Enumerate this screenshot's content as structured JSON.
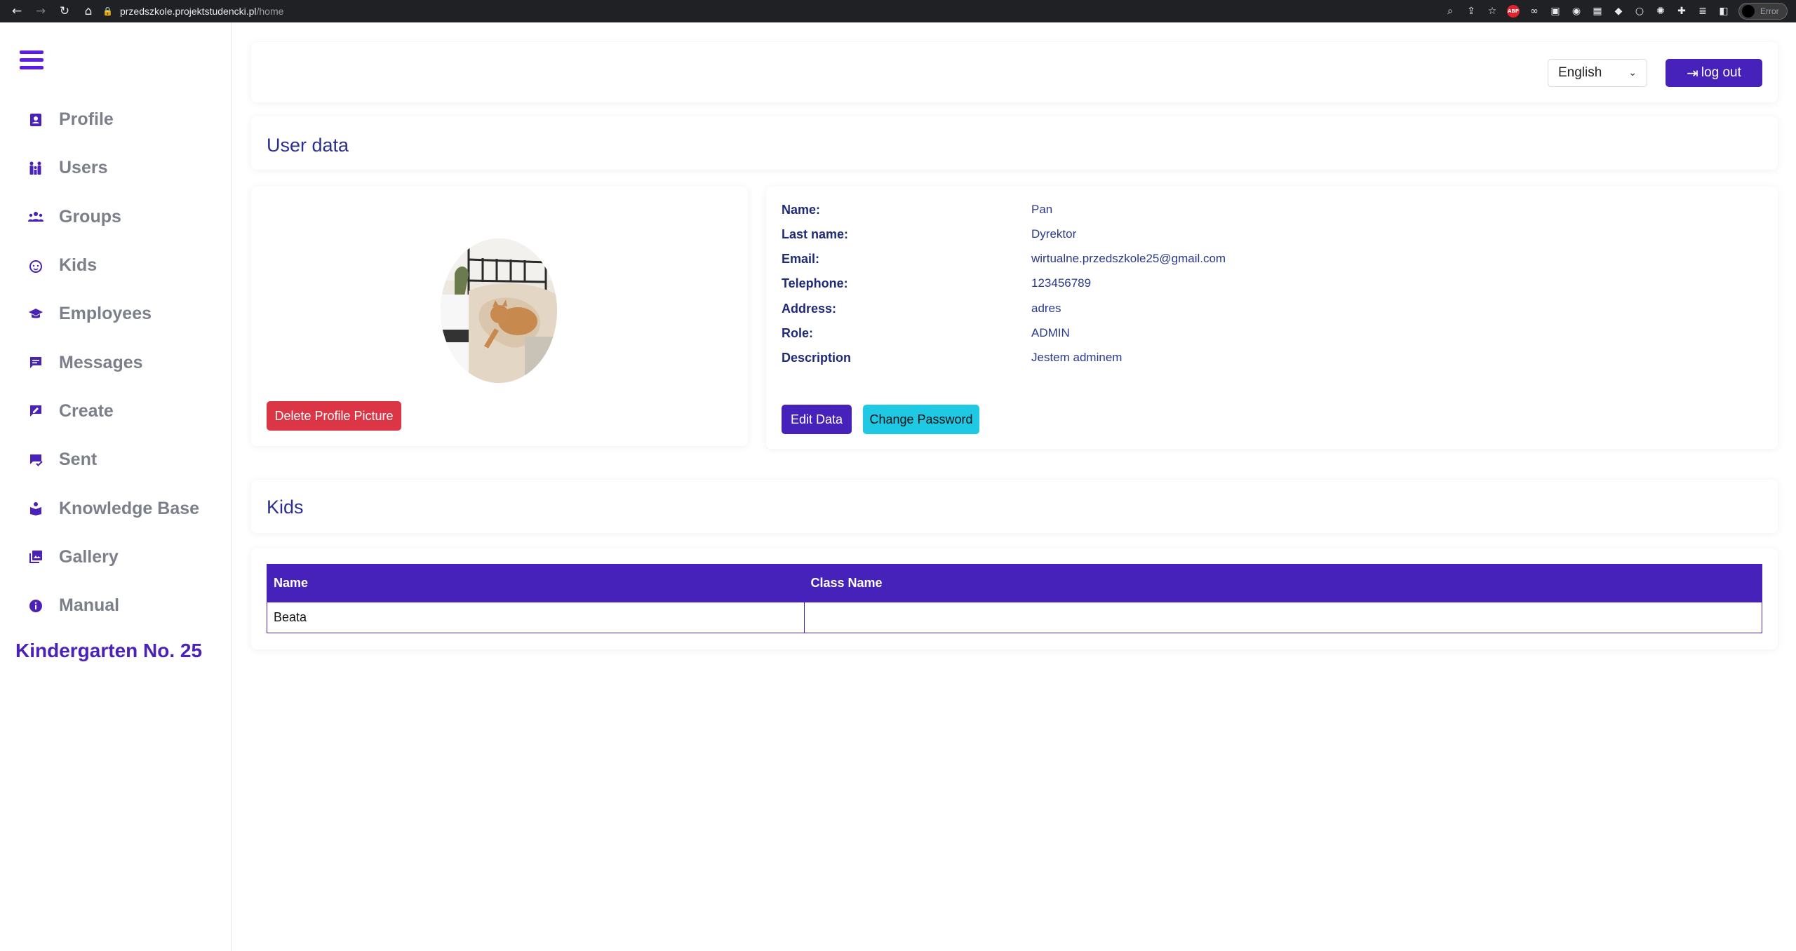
{
  "browser": {
    "url_host": "przedszkole.projektstudencki.pl",
    "url_path": "/home",
    "profile_label": "Error"
  },
  "sidebar": {
    "items": [
      {
        "label": "Profile",
        "icon": "profile-icon"
      },
      {
        "label": "Users",
        "icon": "users-icon"
      },
      {
        "label": "Groups",
        "icon": "groups-icon"
      },
      {
        "label": "Kids",
        "icon": "kids-icon"
      },
      {
        "label": "Employees",
        "icon": "employees-icon"
      },
      {
        "label": "Messages",
        "icon": "messages-icon"
      },
      {
        "label": "Create",
        "icon": "create-icon"
      },
      {
        "label": "Sent",
        "icon": "sent-icon"
      },
      {
        "label": "Knowledge Base",
        "icon": "knowledge-base-icon"
      },
      {
        "label": "Gallery",
        "icon": "gallery-icon"
      },
      {
        "label": "Manual",
        "icon": "info-icon"
      }
    ],
    "brand": "Kindergarten No. 25"
  },
  "header": {
    "language": "English",
    "logout_label": "log out"
  },
  "user_data": {
    "title": "User data",
    "delete_picture_label": "Delete Profile Picture",
    "fields": [
      {
        "key": "Name:",
        "value": "Pan"
      },
      {
        "key": "Last name:",
        "value": "Dyrektor"
      },
      {
        "key": "Email:",
        "value": "wirtualne.przedszkole25@gmail.com"
      },
      {
        "key": "Telephone:",
        "value": "123456789"
      },
      {
        "key": "Address:",
        "value": "adres"
      },
      {
        "key": "Role:",
        "value": "ADMIN"
      },
      {
        "key": "Description",
        "value": "Jestem adminem"
      }
    ],
    "edit_label": "Edit Data",
    "change_password_label": "Change Password"
  },
  "kids": {
    "title": "Kids",
    "columns": [
      "Name",
      "Class Name"
    ],
    "rows": [
      [
        "Beata",
        ""
      ]
    ]
  },
  "colors": {
    "primary": "#4722ba",
    "danger": "#dc3545",
    "info": "#1fc8e3",
    "heading": "#2a2f8f"
  }
}
